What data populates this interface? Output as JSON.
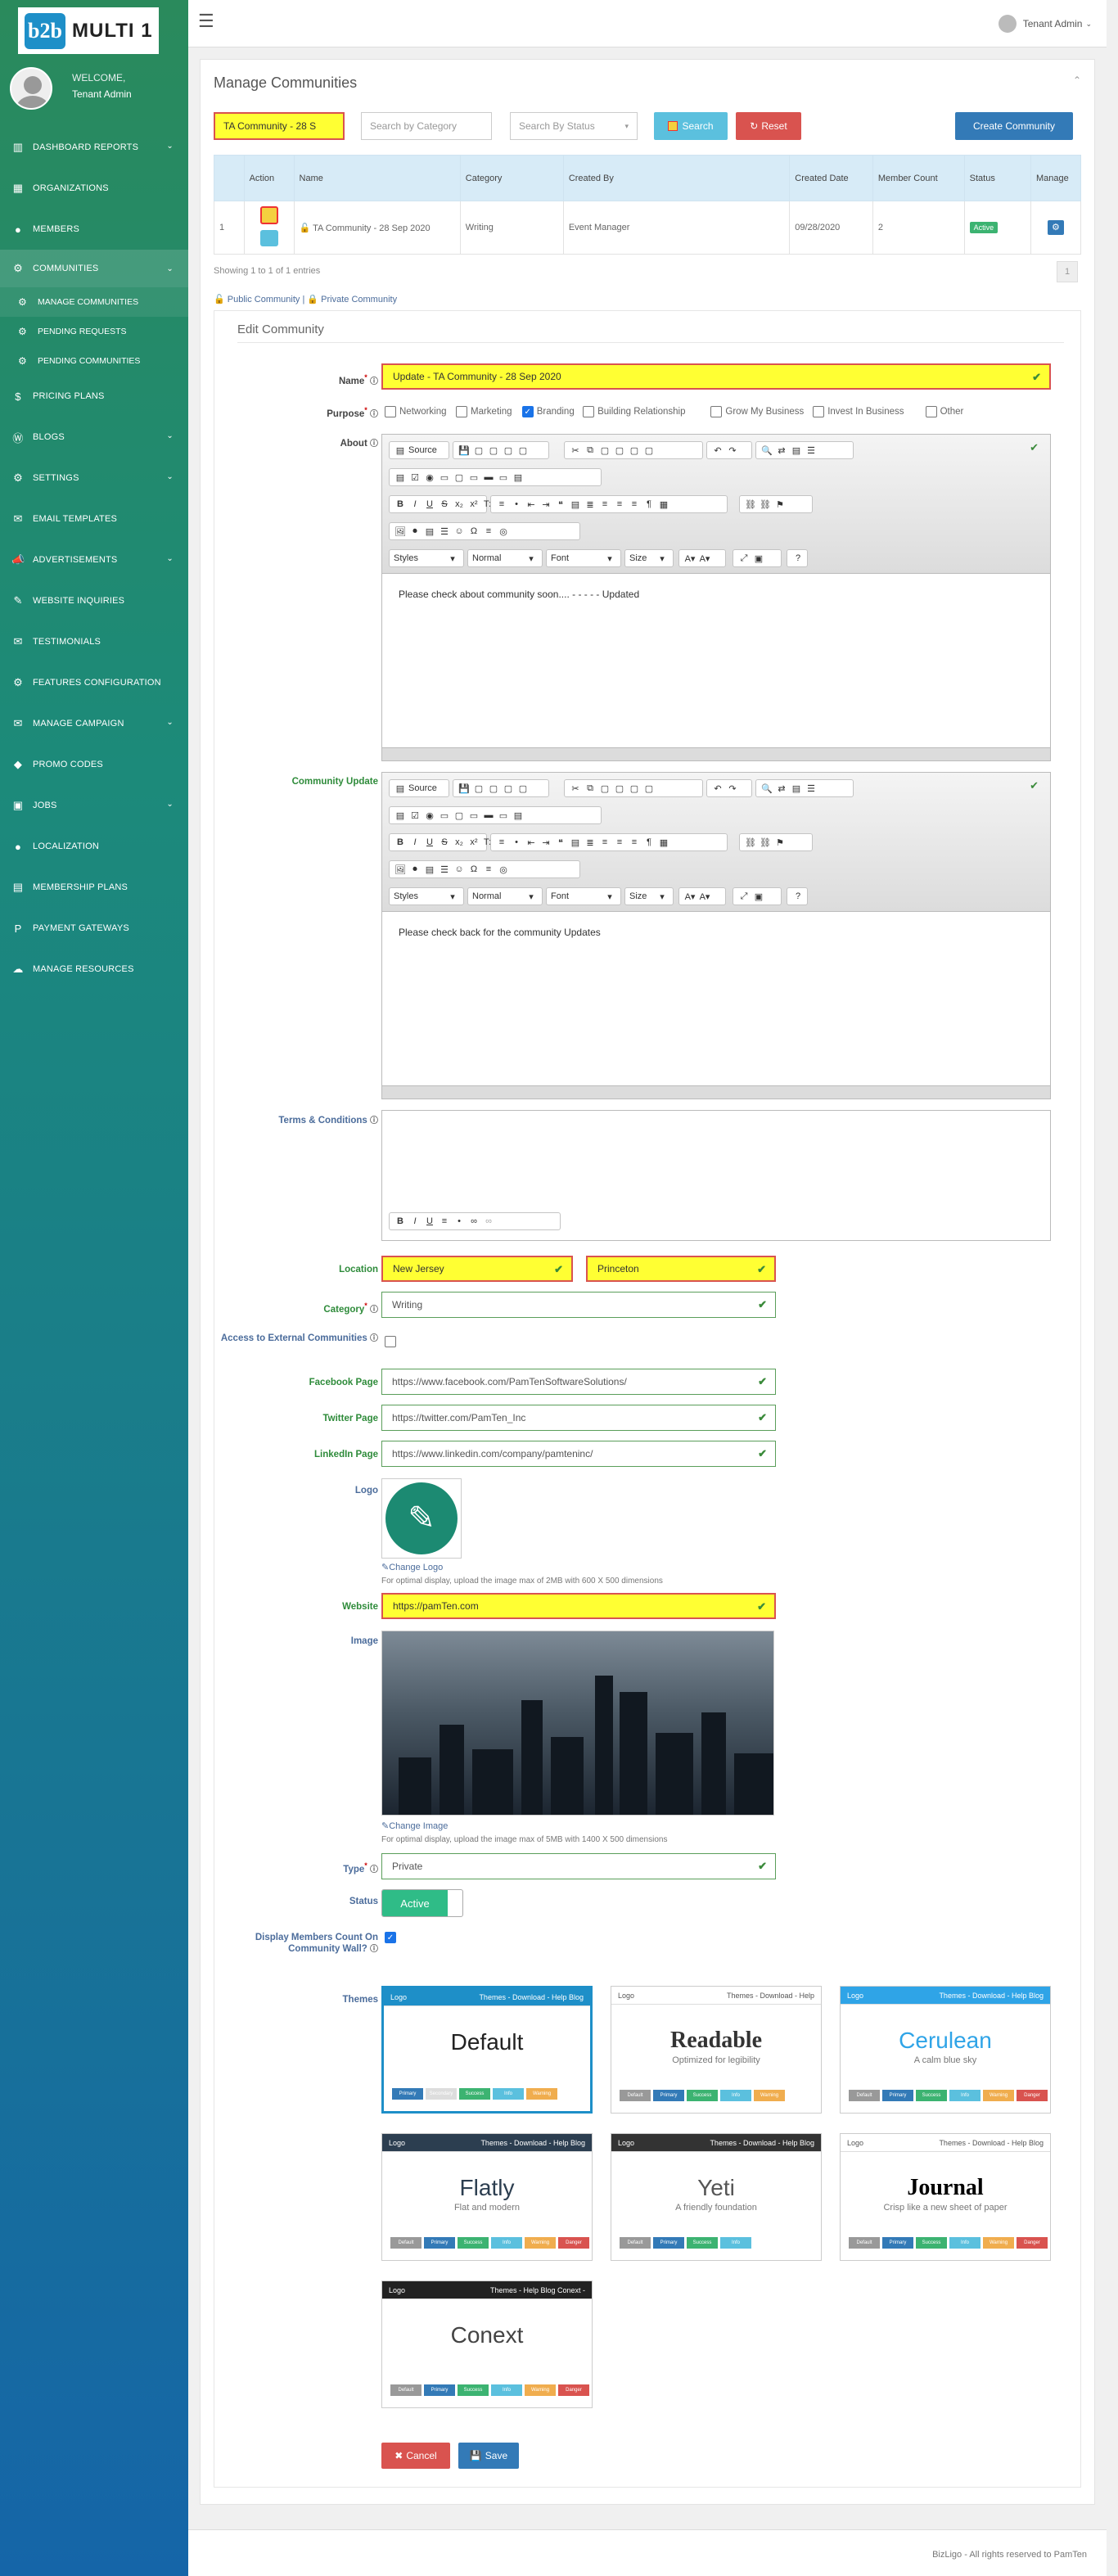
{
  "brand": {
    "logo_mark": "b2b",
    "logo_text": "MULTI 1"
  },
  "user": {
    "welcome": "WELCOME,",
    "name": "Tenant Admin"
  },
  "nav": [
    {
      "label": "DASHBOARD REPORTS",
      "icon": "bar-chart-icon",
      "chev": true
    },
    {
      "label": "ORGANIZATIONS",
      "icon": "building-icon",
      "chev": false
    },
    {
      "label": "MEMBERS",
      "icon": "user-icon",
      "chev": false
    },
    {
      "label": "COMMUNITIES",
      "icon": "gear-icon",
      "chev": true
    },
    {
      "label": "PRICING PLANS",
      "icon": "dollar-icon",
      "chev": false
    },
    {
      "label": "BLOGS",
      "icon": "wordpress-icon",
      "chev": true
    },
    {
      "label": "SETTINGS",
      "icon": "cog-icon",
      "chev": true
    },
    {
      "label": "EMAIL TEMPLATES",
      "icon": "envelope-icon",
      "chev": false
    },
    {
      "label": "ADVERTISEMENTS",
      "icon": "bullhorn-icon",
      "chev": true
    },
    {
      "label": "WEBSITE INQUIRIES",
      "icon": "pencil-icon",
      "chev": false
    },
    {
      "label": "TESTIMONIALS",
      "icon": "comment-icon",
      "chev": false
    },
    {
      "label": "FEATURES CONFIGURATION",
      "icon": "gear-icon",
      "chev": false
    },
    {
      "label": "MANAGE CAMPAIGN",
      "icon": "envelope-icon",
      "chev": true
    },
    {
      "label": "PROMO CODES",
      "icon": "tag-icon",
      "chev": false
    },
    {
      "label": "JOBS",
      "icon": "briefcase-icon",
      "chev": true
    },
    {
      "label": "LOCALIZATION",
      "icon": "user-icon",
      "chev": false
    },
    {
      "label": "MEMBERSHIP PLANS",
      "icon": "money-icon",
      "chev": false
    },
    {
      "label": "PAYMENT GATEWAYS",
      "icon": "paypal-icon",
      "chev": false
    },
    {
      "label": "MANAGE RESOURCES",
      "icon": "cloud-icon",
      "chev": false
    }
  ],
  "subnav": [
    "MANAGE COMMUNITIES",
    "PENDING REQUESTS",
    "PENDING COMMUNITIES"
  ],
  "topbar": {
    "admin": "Tenant Admin"
  },
  "page": {
    "title": "Manage Communities"
  },
  "filters": {
    "name_value": "TA Community - 28 S",
    "category_placeholder": "Search by Category",
    "status_placeholder": "Search By Status",
    "search": "Search",
    "reset": "Reset",
    "create": "Create Community"
  },
  "table": {
    "headers": [
      "Action",
      "Name",
      "Category",
      "Created By",
      "Created Date",
      "Member Count",
      "Status",
      "Manage"
    ],
    "row": {
      "num": "1",
      "name": "TA Community - 28 Sep 2020",
      "category": "Writing",
      "created_by": "Event Manager",
      "created_date": "09/28/2020",
      "member_count": "2",
      "status": "Active"
    }
  },
  "showing": "Showing 1 to 1 of 1 entries",
  "legend": {
    "public": "Public Community",
    "sep": "|",
    "private": "Private Community"
  },
  "page_number": "1",
  "edit": {
    "title": "Edit Community",
    "name_label": "Name",
    "name_value": "Update - TA Community - 28 Sep 2020",
    "purpose_label": "Purpose",
    "purposes": [
      {
        "label": "Networking",
        "on": false
      },
      {
        "label": "Marketing",
        "on": false
      },
      {
        "label": "Branding",
        "on": true
      },
      {
        "label": "Building Relationship",
        "on": false
      },
      {
        "label": "Grow My Business",
        "on": false
      },
      {
        "label": "Invest In Business",
        "on": false
      },
      {
        "label": "Other",
        "on": false
      }
    ],
    "about_label": "About",
    "about_text": "Please check about community soon.... - - - - - Updated",
    "update_label": "Community Update",
    "update_text": "Please check back for the community Updates",
    "terms_label": "Terms & Conditions",
    "location_label": "Location",
    "location_state": "New Jersey",
    "location_city": "Princeton",
    "category_label": "Category",
    "category_value": "Writing",
    "external_label": "Access to External Communities",
    "facebook_label": "Facebook Page",
    "facebook_value": "https://www.facebook.com/PamTenSoftwareSolutions/",
    "twitter_label": "Twitter Page",
    "twitter_value": "https://twitter.com/PamTen_Inc",
    "linkedin_label": "LinkedIn Page",
    "linkedin_value": "https://www.linkedin.com/company/pamteninc/",
    "logo_label": "Logo",
    "change_logo": "Change Logo",
    "logo_note": "For optimal display, upload the image max of 2MB with 600 X 500 dimensions",
    "website_label": "Website",
    "website_value": "https://pamTen.com",
    "image_label": "Image",
    "change_image": "Change Image",
    "image_note": "For optimal display, upload the image max of 5MB with 1400 X 500 dimensions",
    "type_label": "Type",
    "type_value": "Private",
    "status_label": "Status",
    "status_value": "Active",
    "display_label": "Display Members Count On Community Wall?",
    "themes_label": "Themes",
    "cancel": "Cancel",
    "save": "Save"
  },
  "editor_selects": [
    "Styles",
    "Normal",
    "Font",
    "Size"
  ],
  "editor_source": "Source",
  "themes": [
    {
      "name": "Default",
      "sub": "",
      "bar": "#1e8fc8",
      "logo": "Logo",
      "menu": "Themes - Download - Help Blog",
      "font": "Liberation Sans",
      "color": "#222",
      "btns": [
        "Primary",
        "Secondary",
        "Success",
        "Info",
        "Warning"
      ]
    },
    {
      "name": "Readable",
      "sub": "Optimized for legibility",
      "bar": "#ffffff",
      "logo": "Logo",
      "menu": "Themes - Download - Help",
      "font": "Liberation Serif",
      "color": "#333",
      "btns": [
        "Default",
        "Primary",
        "Success",
        "Info",
        "Warning"
      ]
    },
    {
      "name": "Cerulean",
      "sub": "A calm blue sky",
      "bar": "#2fa4e7",
      "logo": "Logo",
      "menu": "Themes - Download - Help Blog",
      "font": "Liberation Sans",
      "color": "#2fa4e7",
      "btns": [
        "Default",
        "Primary",
        "Success",
        "Info",
        "Warning",
        "Danger"
      ]
    },
    {
      "name": "Flatly",
      "sub": "Flat and modern",
      "bar": "#2c3e50",
      "logo": "Logo",
      "menu": "Themes - Download - Help Blog",
      "font": "Liberation Sans",
      "color": "#2c3e50",
      "btns": [
        "Default",
        "Primary",
        "Success",
        "Info",
        "Warning",
        "Danger"
      ]
    },
    {
      "name": "Yeti",
      "sub": "A friendly foundation",
      "bar": "#333333",
      "logo": "Logo",
      "menu": "Themes - Download - Help Blog",
      "font": "Liberation Sans",
      "color": "#555",
      "btns": [
        "Default",
        "Primary",
        "Success",
        "Info"
      ]
    },
    {
      "name": "Journal",
      "sub": "Crisp like a new sheet of paper",
      "bar": "#ffffff",
      "logo": "Logo",
      "menu": "Themes - Download - Help Blog",
      "font": "Liberation Serif",
      "color": "#000",
      "btns": [
        "Default",
        "Primary",
        "Success",
        "Info",
        "Warning",
        "Danger"
      ]
    },
    {
      "name": "Conext",
      "sub": "",
      "bar": "#222222",
      "logo": "Logo",
      "menu": "Themes - Help Blog Conext -",
      "font": "Liberation Sans",
      "color": "#444",
      "btns": [
        "Default",
        "Primary",
        "Success",
        "Info",
        "Warning",
        "Danger"
      ]
    }
  ],
  "footer": "BizLigo - All rights reserved to PamTen"
}
